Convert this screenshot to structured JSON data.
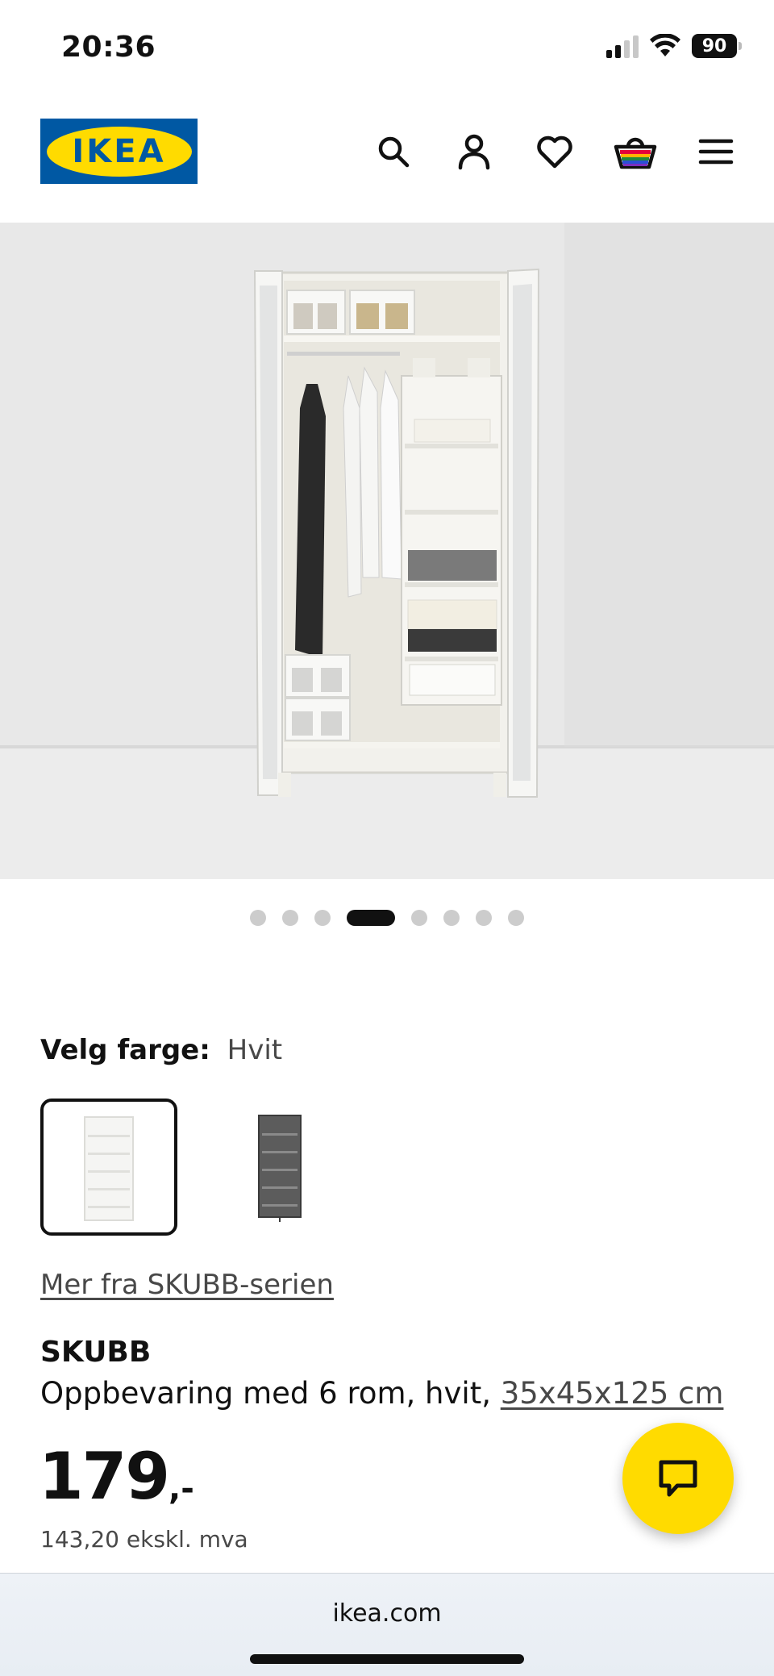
{
  "status_bar": {
    "time": "20:36",
    "battery": "90"
  },
  "header": {
    "logo_text": "IKEA",
    "icons": [
      "search-icon",
      "account-icon",
      "heart-icon",
      "basket-icon",
      "menu-icon"
    ]
  },
  "gallery": {
    "total_images": 8,
    "active_index": 3
  },
  "color": {
    "label": "Velg farge:",
    "value": "Hvit",
    "options": [
      "white",
      "dark-grey"
    ]
  },
  "series_link": "Mer fra SKUBB-serien",
  "product": {
    "name": "SKUBB",
    "description": "Oppbevaring med 6 rom, hvit, ",
    "size": "35x45x125 cm",
    "price_int": "179",
    "price_suffix": ",-",
    "price_ex_vat": "143,20 ekskl. mva"
  },
  "browser": {
    "url": "ikea.com"
  },
  "colors": {
    "ikea_blue": "#0058a3",
    "ikea_yellow": "#ffdb00"
  }
}
